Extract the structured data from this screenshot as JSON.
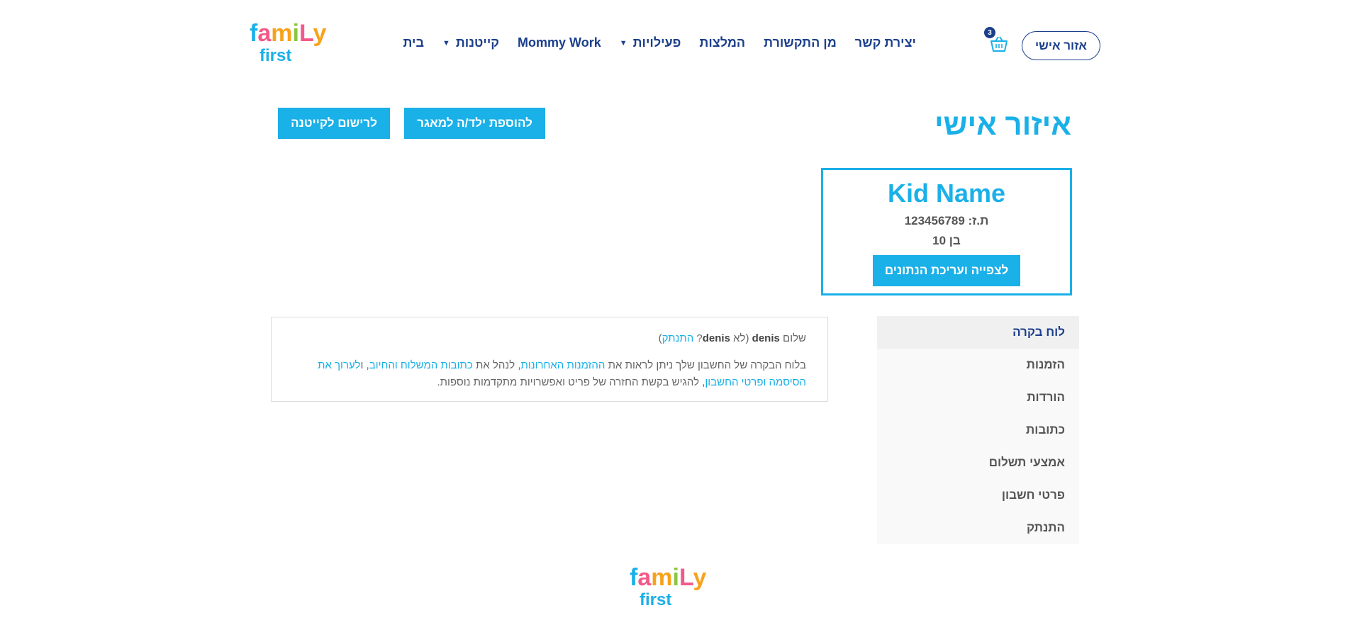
{
  "header": {
    "logo_top": "family",
    "logo_bottom": "first",
    "nav": [
      {
        "label": "בית",
        "has_dropdown": false
      },
      {
        "label": "קייטנות",
        "has_dropdown": true
      },
      {
        "label": "Mommy Work",
        "has_dropdown": false
      },
      {
        "label": "פעילויות",
        "has_dropdown": true
      },
      {
        "label": "המלצות",
        "has_dropdown": false
      },
      {
        "label": "מן התקשורת",
        "has_dropdown": false
      },
      {
        "label": "יצירת קשר",
        "has_dropdown": false
      }
    ],
    "cart_count": "3",
    "cart_icon": "basket-icon",
    "login_label": "אזור אישי"
  },
  "page": {
    "title": "איזור אישי",
    "add_child_button": "להוספת ילד/ה למאגר",
    "register_button": "לרישום לקייטנה"
  },
  "kid_card": {
    "name": "Kid Name",
    "id_text": "ת.ז: 123456789",
    "age_text": "בן 10",
    "view_edit_button": "לצפייה ועריכת הנתונים"
  },
  "account_nav": [
    {
      "label": "לוח בקרה",
      "active": true
    },
    {
      "label": "הזמנות",
      "active": false
    },
    {
      "label": "הורדות",
      "active": false
    },
    {
      "label": "כתובות",
      "active": false
    },
    {
      "label": "אמצעי תשלום",
      "active": false
    },
    {
      "label": "פרטי חשבון",
      "active": false
    },
    {
      "label": "התנתק",
      "active": false
    }
  ],
  "welcome": {
    "hello": "שלום",
    "username": "denis",
    "not_prefix": "(לא",
    "not_user": "denis",
    "question": "?",
    "logout_link": "התנתק",
    "close_paren": ")",
    "p1": "בלוח הבקרה של החשבון שלך ניתן לראות את",
    "recent_orders_link": "ההזמנות האחרונות",
    "p2": ", לנהל את",
    "addresses_link": "כתובות המשלוח והחיוב",
    "p3": ", ו",
    "password_link": "לערוך את הסיסמה",
    "account_details_link": "ופרטי החשבון",
    "p4": ", להגיש בקשת החזרה של פריט ואפשרויות מתקדמות נוספות."
  },
  "colors": {
    "brand_blue": "#1ab0e8",
    "navy": "#1b3f8b"
  }
}
